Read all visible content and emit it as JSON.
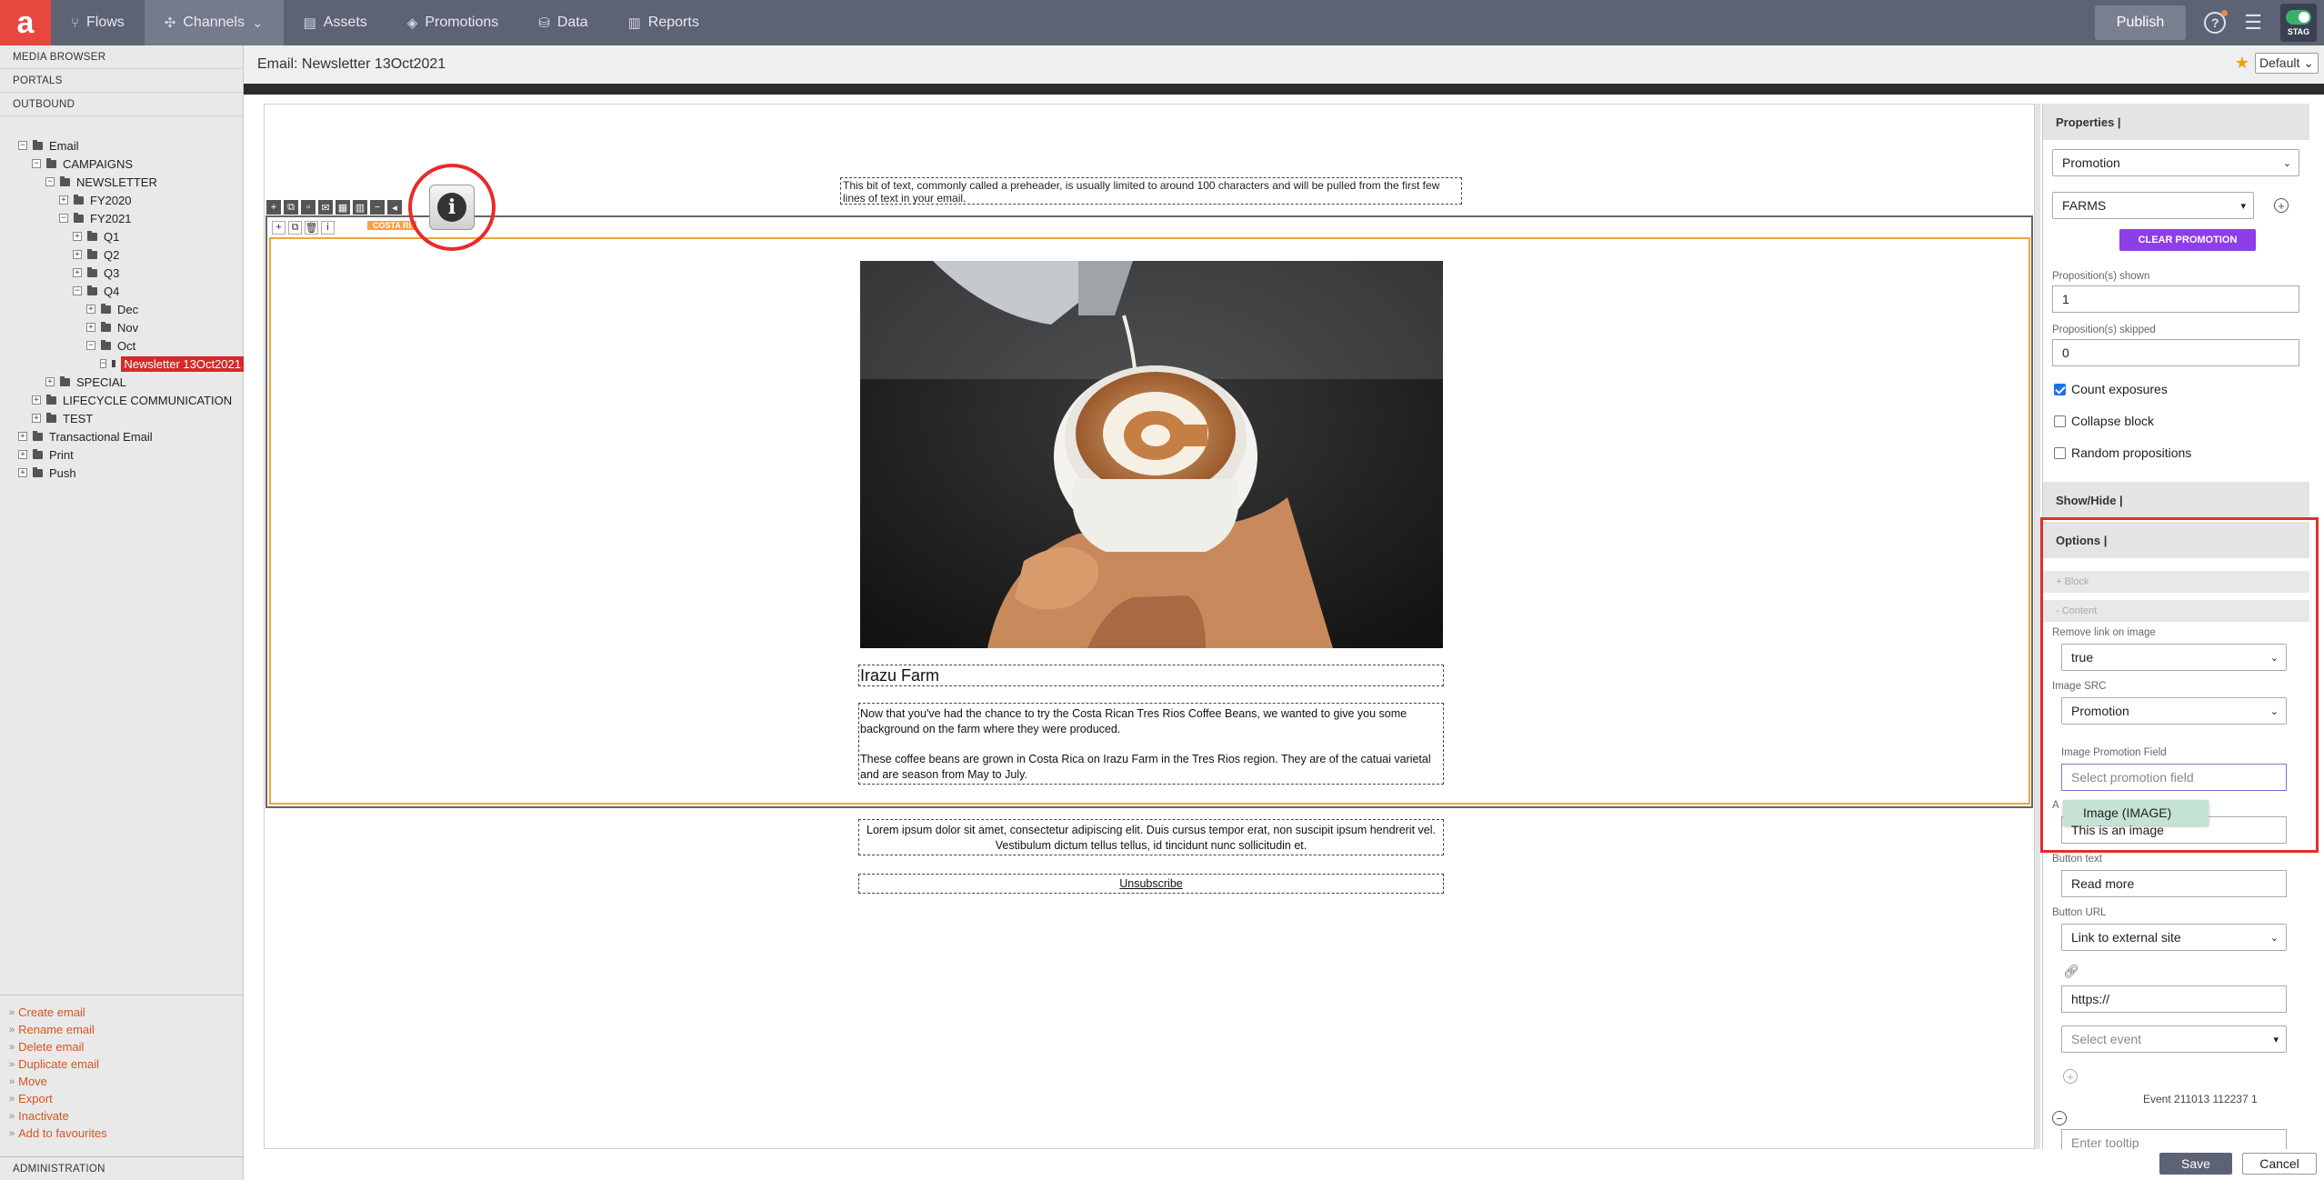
{
  "nav": {
    "logo": "a",
    "items": [
      {
        "label": "Flows",
        "icon": "flows-icon"
      },
      {
        "label": "Channels",
        "icon": "channels-icon"
      },
      {
        "label": "Assets",
        "icon": "assets-icon"
      },
      {
        "label": "Promotions",
        "icon": "promotions-icon"
      },
      {
        "label": "Data",
        "icon": "data-icon"
      },
      {
        "label": "Reports",
        "icon": "reports-icon"
      }
    ],
    "publish": "Publish",
    "env_badge": "STAG"
  },
  "sidebar": {
    "headers": [
      "MEDIA BROWSER",
      "PORTALS",
      "OUTBOUND"
    ],
    "tree": [
      {
        "label": "Email",
        "toggle": "−"
      },
      {
        "label": "CAMPAIGNS",
        "toggle": "−"
      },
      {
        "label": "NEWSLETTER",
        "toggle": "−"
      },
      {
        "label": "FY2020",
        "toggle": "+"
      },
      {
        "label": "FY2021",
        "toggle": "−"
      },
      {
        "label": "Q1",
        "toggle": "+"
      },
      {
        "label": "Q2",
        "toggle": "+"
      },
      {
        "label": "Q3",
        "toggle": "+"
      },
      {
        "label": "Q4",
        "toggle": "−"
      },
      {
        "label": "Dec",
        "toggle": "+"
      },
      {
        "label": "Nov",
        "toggle": "+"
      },
      {
        "label": "Oct",
        "toggle": "−"
      },
      {
        "label": "Newsletter 13Oct2021",
        "toggle": "−"
      },
      {
        "label": "SPECIAL",
        "toggle": "+"
      },
      {
        "label": "LIFECYCLE COMMUNICATION",
        "toggle": "+"
      },
      {
        "label": "TEST",
        "toggle": "+"
      },
      {
        "label": "Transactional Email",
        "toggle": "+"
      },
      {
        "label": "Print",
        "toggle": "+"
      },
      {
        "label": "Push",
        "toggle": "+"
      }
    ],
    "actions": [
      "Create email",
      "Rename email",
      "Delete email",
      "Duplicate email",
      "Move",
      "Export",
      "Inactivate",
      "Add to favourites"
    ],
    "admin": "ADMINISTRATION"
  },
  "titlebar": {
    "title": "Email: Newsletter 13Oct2021",
    "default_select": "Default"
  },
  "canvas": {
    "preheader": "This bit of text, commonly called a preheader, is usually limited to around 100 characters and will be pulled from the first few lines of text in your email.",
    "block_label": "COSTA RI",
    "heading": "Irazu Farm",
    "body_p1": "Now that you've had the chance to try the Costa Rican Tres Rios Coffee Beans, we wanted to give you some background on the farm where they were produced.",
    "body_p2": "These coffee beans are grown in Costa Rica on Irazu Farm in the Tres Rios region. They are of the catuai varietal and are season from May to July.",
    "footer": "Lorem ipsum dolor sit amet, consectetur adipiscing elit. Duis cursus tempor erat, non suscipit ipsum hendrerit vel. Vestibulum dictum tellus tellus, id tincidunt nunc sollicitudin et.",
    "unsubscribe": "Unsubscribe"
  },
  "panel": {
    "properties": "Properties |",
    "type_select": "Promotion",
    "promo_select": "FARMS",
    "clear_promotion": "CLEAR PROMOTION",
    "shown_label": "Proposition(s) shown",
    "shown_value": "1",
    "skipped_label": "Proposition(s) skipped",
    "skipped_value": "0",
    "count_exposures": "Count exposures",
    "collapse_block": "Collapse block",
    "random_propositions": "Random propositions",
    "show_hide": "Show/Hide |",
    "options": "Options |",
    "block_sub": "+ Block",
    "content_sub": "- Content",
    "remove_link_label": "Remove link on image",
    "remove_link_value": "true",
    "image_src_label": "Image SRC",
    "image_src_value": "Promotion",
    "image_promo_field_label": "Image Promotion Field",
    "image_promo_field_placeholder": "Select promotion field",
    "dropdown_option": "Image (IMAGE)",
    "alt_label_fragment": "A",
    "alt_value": "This is an image",
    "button_text_label": "Button text",
    "button_text_value": "Read more",
    "button_url_label": "Button URL",
    "button_url_value": "Link to external site",
    "url_value": "https://",
    "event_placeholder": "Select event",
    "event_text": "Event 211013 112237 1",
    "tooltip_placeholder": "Enter tooltip"
  },
  "footer_buttons": {
    "save": "Save",
    "cancel": "Cancel"
  }
}
